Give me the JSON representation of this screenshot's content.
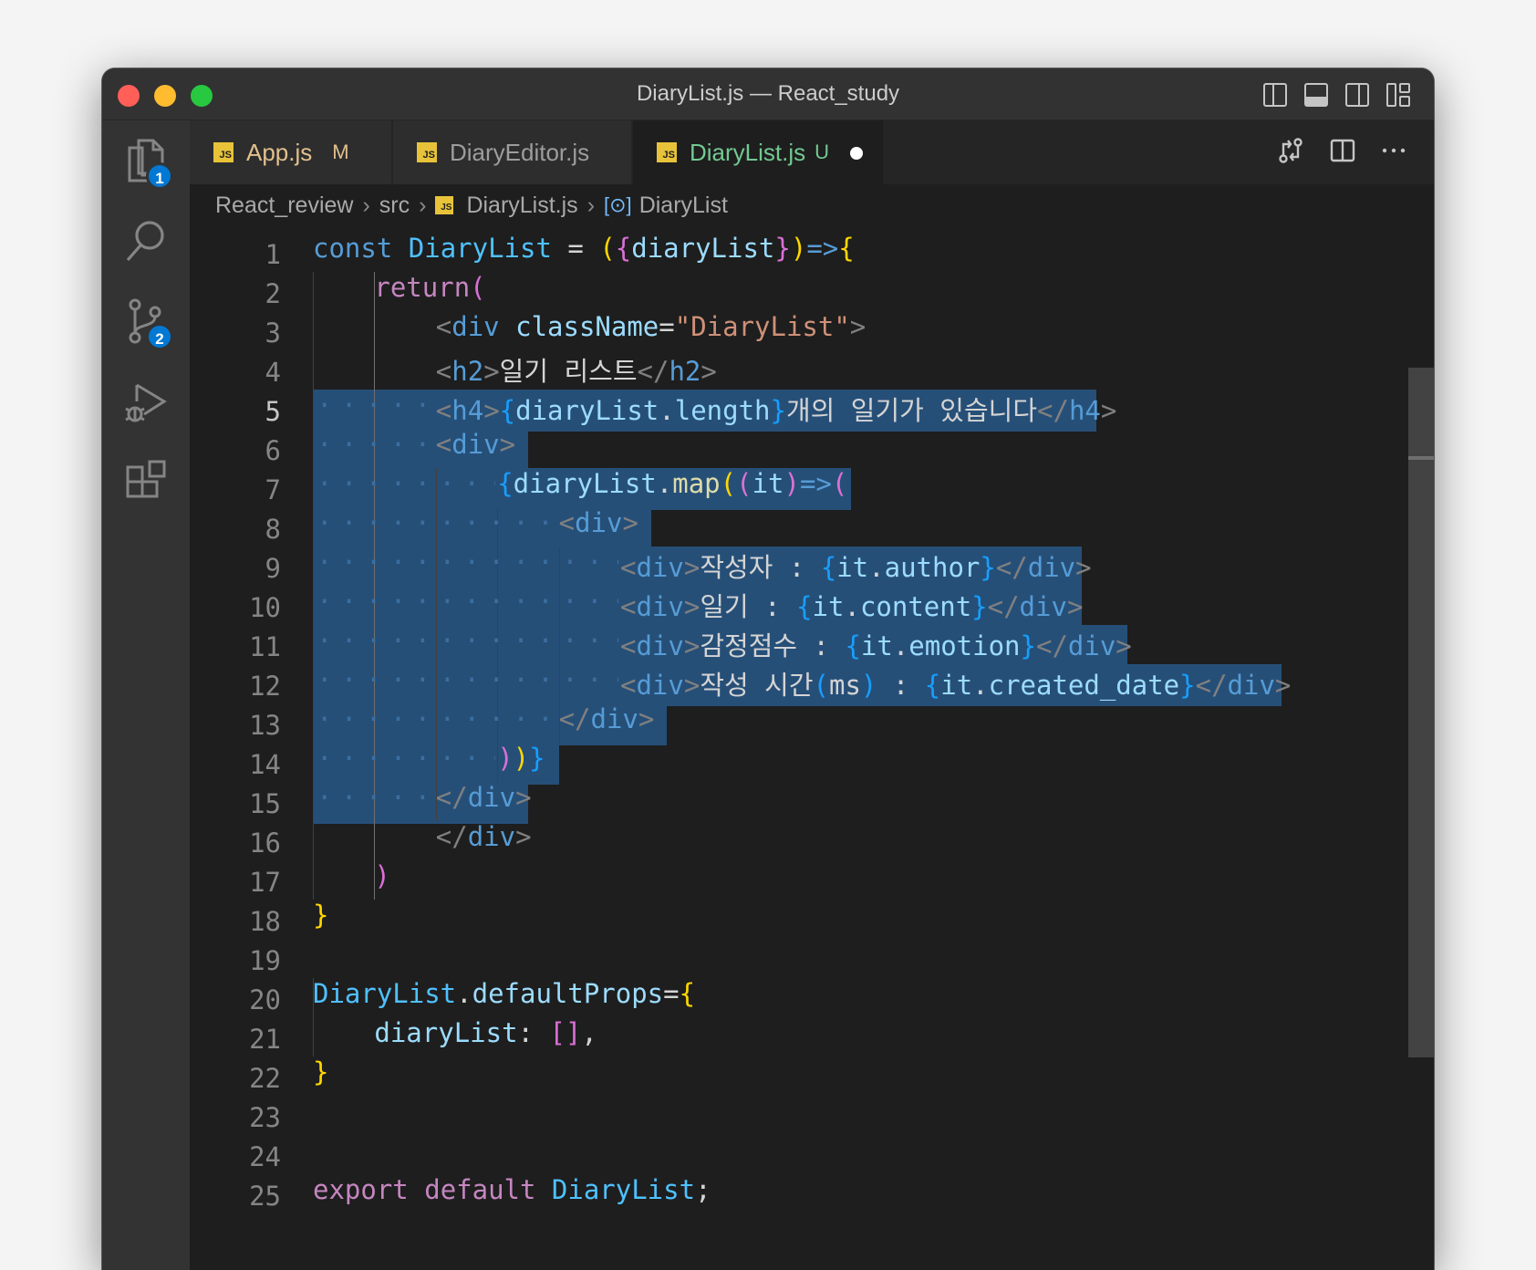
{
  "window": {
    "title": "DiaryList.js — React_study"
  },
  "activity_bar": {
    "explorer_badge": "1",
    "source_control_badge": "2"
  },
  "tabs": [
    {
      "label": "App.js",
      "status": "M",
      "label_color": "#e2c08d",
      "status_color": "#e2c08d",
      "icon": "js-file-icon"
    },
    {
      "label": "DiaryEditor.js",
      "status": "",
      "label_color": "#9d9d9d",
      "status_color": "#9d9d9d",
      "icon": "js-file-icon"
    },
    {
      "label": "DiaryList.js",
      "status": "U",
      "label_color": "#73c991",
      "status_color": "#73c991",
      "icon": "js-file-icon",
      "modified_dot": true
    }
  ],
  "breadcrumb": {
    "items": [
      "React_review",
      "src",
      "DiaryList.js",
      "DiaryList"
    ],
    "file_icon_text": "JS"
  },
  "editor": {
    "current_line": "5",
    "line_numbers": [
      "1",
      "2",
      "3",
      "4",
      "5",
      "6",
      "7",
      "8",
      "9",
      "10",
      "11",
      "12",
      "13",
      "14",
      "15",
      "16",
      "17",
      "18",
      "19",
      "20",
      "21",
      "22",
      "23",
      "24",
      "25"
    ],
    "lines": [
      "const DiaryList = ({diaryList})=>{",
      "    return(",
      "        <div className=\"DiaryList\">",
      "        <h2>일기 리스트</h2>",
      "        <h4>{diaryList.length}개의 일기가 있습니다</h4>",
      "        <div>",
      "            {diaryList.map((it)=>(",
      "                <div>",
      "                    <div>작성자 : {it.author}</div>",
      "                    <div>일기 : {it.content}</div>",
      "                    <div>감정점수 : {it.emotion}</div>",
      "                    <div>작성 시간(ms) : {it.created_date}</div>",
      "                </div>",
      "            ))}",
      "        </div>",
      "        </div>",
      "    )",
      "}",
      "",
      "DiaryList.defaultProps={",
      "    diaryList: [],",
      "}",
      "",
      "",
      "export default DiaryList;"
    ]
  },
  "colors": {
    "editor_bg": "#1e1e1e",
    "selection": "#264f78",
    "keyword": "#569cd6",
    "string": "#ce9178",
    "control": "#c586c0"
  }
}
